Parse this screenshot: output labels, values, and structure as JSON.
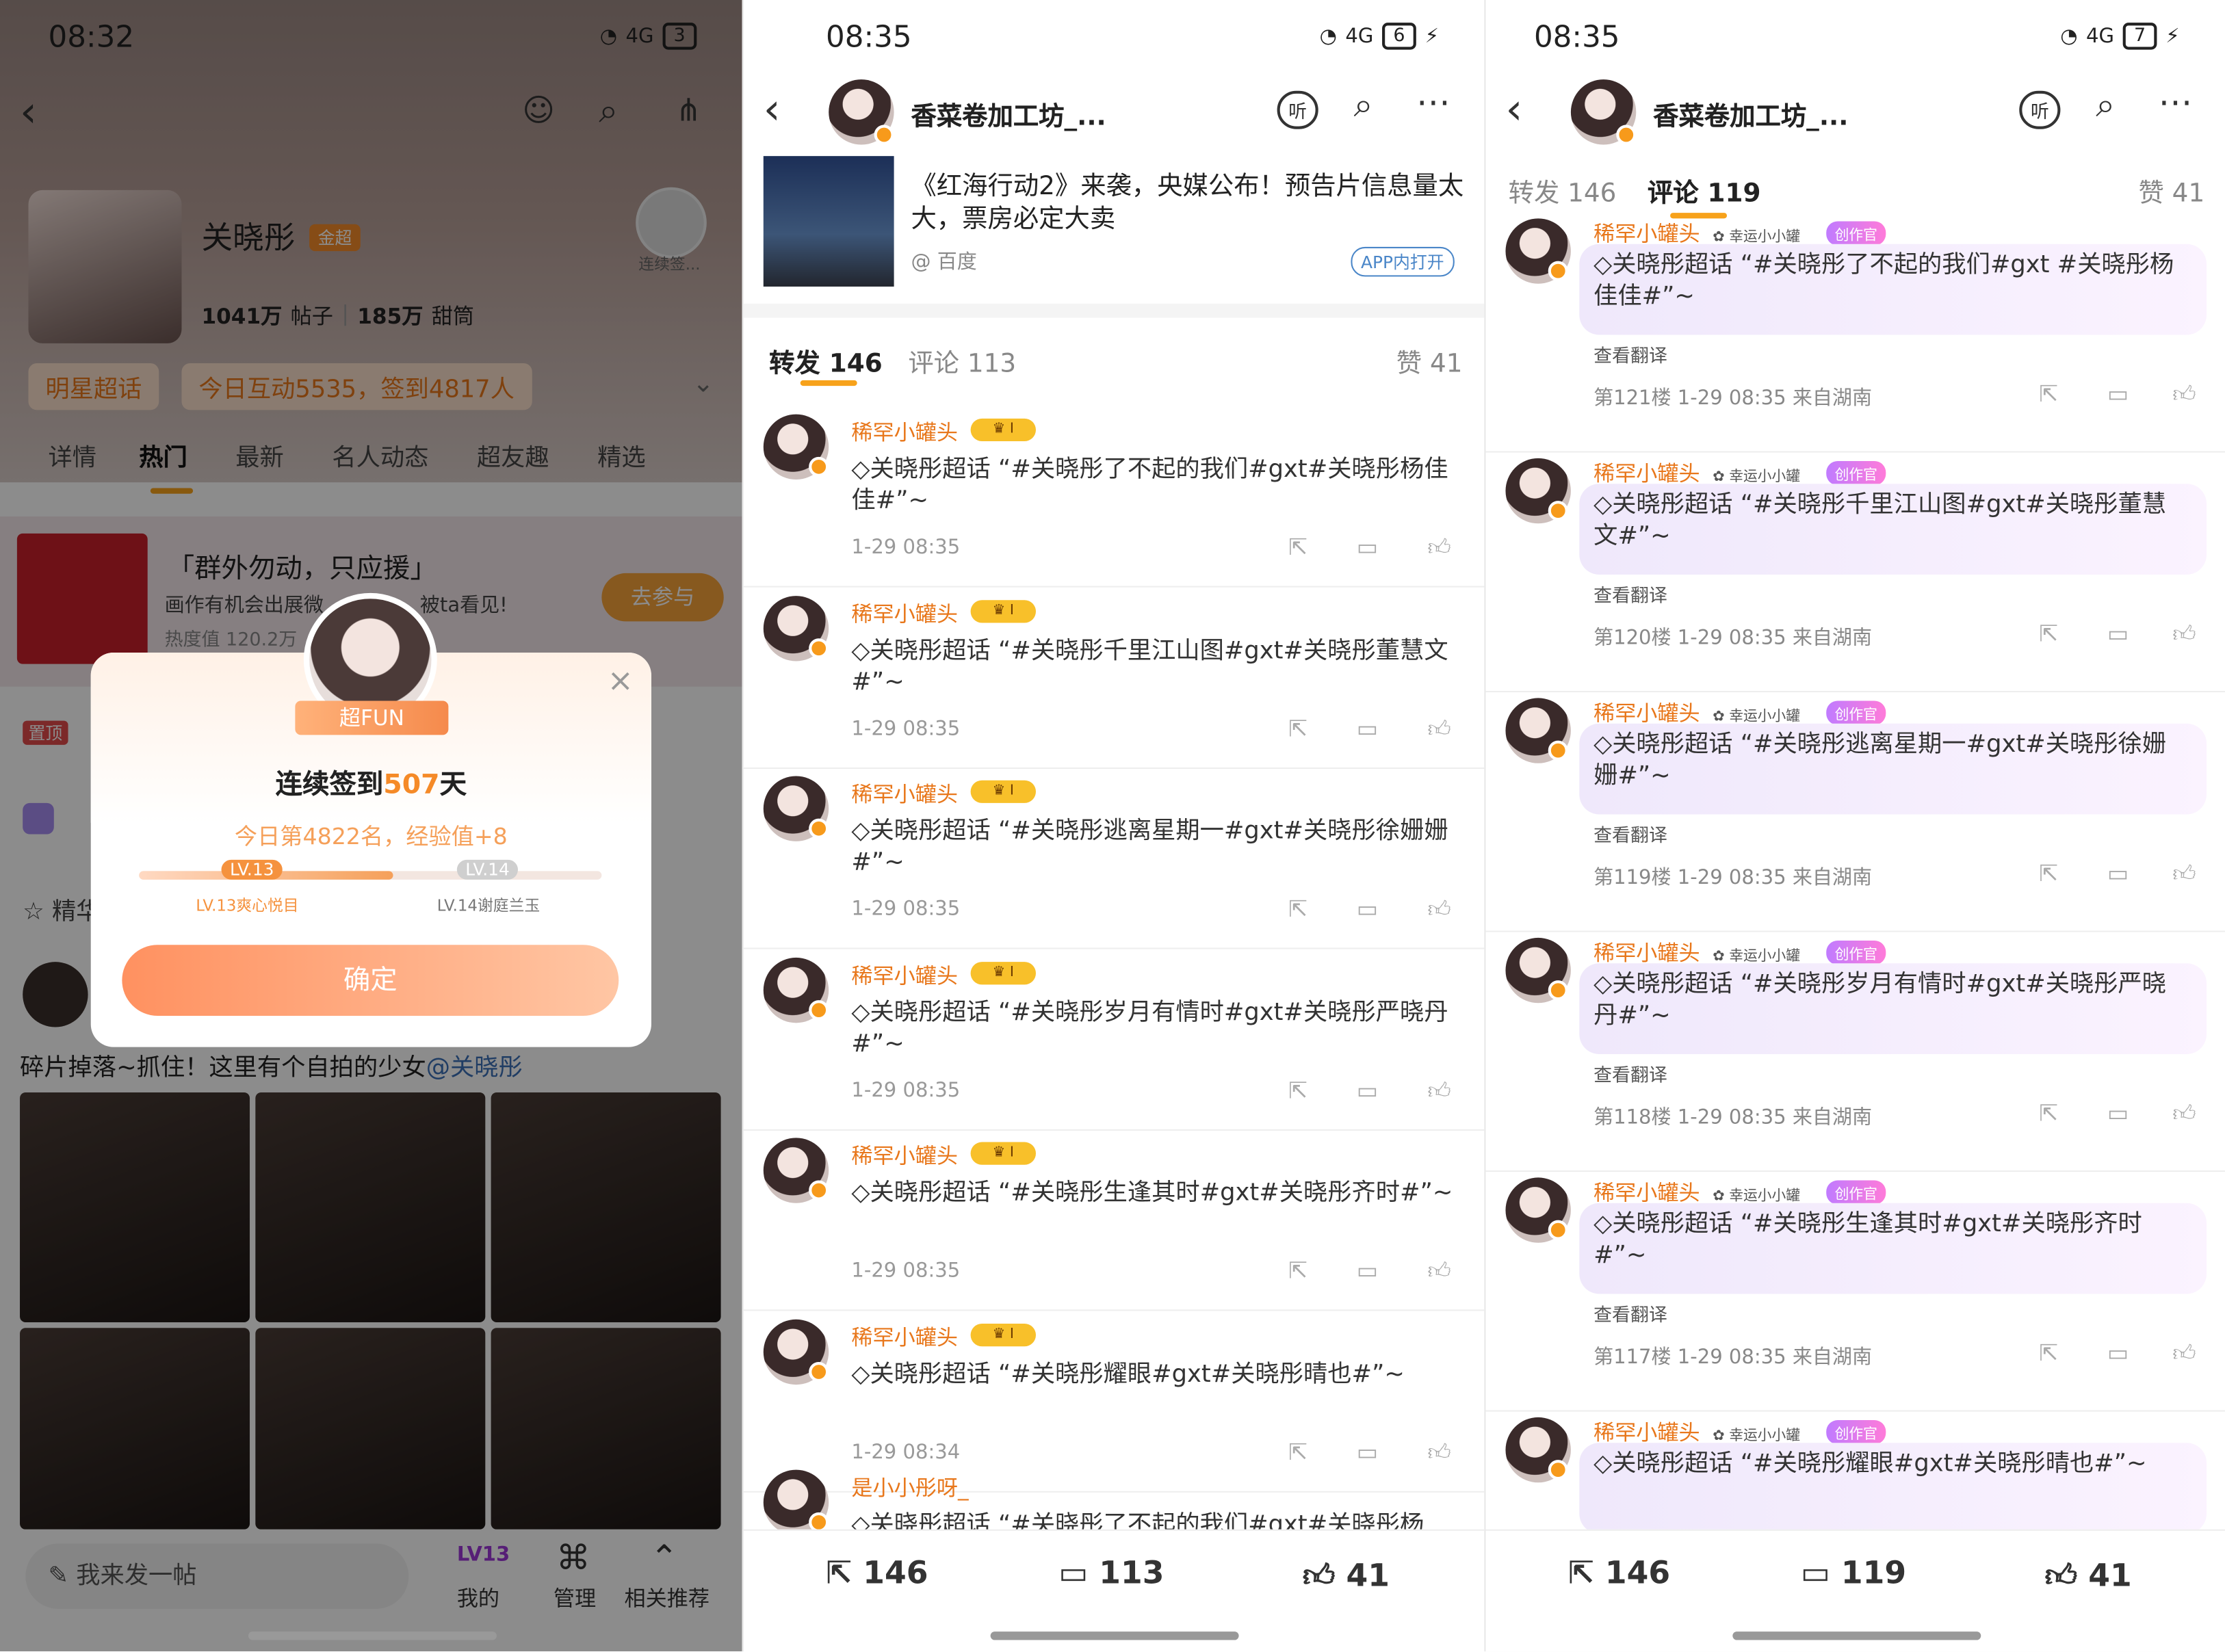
{
  "panel_left": {
    "status_time": "08:32",
    "battery": "3",
    "network": "4G",
    "topic_name": "关晓彤",
    "badge_level": "金超",
    "checkin_label": "连续签...",
    "stats_posts_value": "1041万",
    "stats_posts_label": "帖子",
    "stats_fans_value": "185万",
    "stats_fans_label": "甜筒",
    "tag_super": "明星超话",
    "tag_interaction": "今日互动5535，签到4817人",
    "tabs": [
      "详情",
      "热门",
      "最新",
      "名人动态",
      "超友趣",
      "精选"
    ],
    "banner_title": "「群外勿动，只应援」",
    "banner_sub": "画作有机会出展微",
    "banner_sub2": "被ta看见!",
    "banner_heat": "热度值 120.2万",
    "banner_join": "去参与",
    "pinned_label": "置顶",
    "fav_label": "精华",
    "post_text": "碎片掉落~抓住！这里有个自拍的少女",
    "post_mention": "@关晓彤",
    "compose_placeholder": "我来发一帖",
    "nav": [
      "我的",
      "管理",
      "相关推荐"
    ],
    "nav_level": "LV13",
    "modal": {
      "badge": "超FUN",
      "title_prefix": "连续签到",
      "days": "507",
      "title_suffix": "天",
      "rank_line": "今日第4822名，经验值+8",
      "level_current": "LV.13",
      "level_next": "LV.14",
      "level_current_name": "LV.13爽心悦目",
      "level_next_name": "LV.14谢庭兰玉",
      "level_progress_pct": 55,
      "confirm": "确定"
    }
  },
  "panel_middle": {
    "status_time": "08:35",
    "battery": "6",
    "network": "4G",
    "account_name": "香菜卷加工坊_...",
    "listen": "听",
    "article_title": "《红海行动2》来袭，央媒公布！预告片信息量太大，票房必定大卖",
    "article_source": "@ 百度",
    "article_open": "APP内打开",
    "tab_repost": "转发 146",
    "tab_comment": "评论 113",
    "likes": "赞 41",
    "reposts": [
      {
        "user": "稀罕小罐头",
        "text": "关晓彤超话 “#关晓彤了不起的我们#gxt#关晓彤杨佳佳#”~",
        "time": "1-29 08:35"
      },
      {
        "user": "稀罕小罐头",
        "text": "关晓彤超话 “#关晓彤千里江山图#gxt#关晓彤董慧文#”~",
        "time": "1-29 08:35"
      },
      {
        "user": "稀罕小罐头",
        "text": "关晓彤超话 “#关晓彤逃离星期一#gxt#关晓彤徐姗姗#”~",
        "time": "1-29 08:35"
      },
      {
        "user": "稀罕小罐头",
        "text": "关晓彤超话 “#关晓彤岁月有情时#gxt#关晓彤严晓丹#”~",
        "time": "1-29 08:35"
      },
      {
        "user": "稀罕小罐头",
        "text": "关晓彤超话 “#关晓彤生逢其时#gxt#关晓彤齐时#”~",
        "time": "1-29 08:35"
      },
      {
        "user": "稀罕小罐头",
        "text": "关晓彤超话 “#关晓彤耀眼#gxt#关晓彤晴也#”~",
        "time": "1-29 08:34"
      },
      {
        "user": "是小小彤呀_",
        "text": "关晓彤超话 “#关晓彤了不起的我们#gxt#关晓彤杨",
        "time": ""
      }
    ],
    "bottom": {
      "repost": "146",
      "comment": "113",
      "like": "41"
    }
  },
  "panel_right": {
    "status_time": "08:35",
    "battery": "7",
    "network": "4G",
    "account_name": "香菜卷加工坊_...",
    "listen": "听",
    "tab_repost": "转发 146",
    "tab_comment": "评论 119",
    "likes": "赞 41",
    "fan_label": "幸运小小罐",
    "creator_label": "创作官",
    "translate": "查看翻译",
    "comments": [
      {
        "user": "稀罕小罐头",
        "text": "关晓彤超话 “#关晓彤了不起的我们#",
        "text2": "gxt #关晓彤杨佳佳#”~",
        "meta": "第121楼 1-29 08:35 来自湖南"
      },
      {
        "user": "稀罕小罐头",
        "text": "关晓彤超话 “#关晓彤千里江山图#gxt#关晓彤董慧文#”~",
        "text2": "",
        "meta": "第120楼 1-29 08:35 来自湖南"
      },
      {
        "user": "稀罕小罐头",
        "text": "关晓彤超话 “#关晓彤逃离星期一#gxt#关晓彤徐姗姗#”~",
        "text2": "",
        "meta": "第119楼 1-29 08:35 来自湖南"
      },
      {
        "user": "稀罕小罐头",
        "text": "关晓彤超话 “#关晓彤岁月有情时#gxt#关晓彤严晓丹#”~",
        "text2": "",
        "meta": "第118楼 1-29 08:35 来自湖南"
      },
      {
        "user": "稀罕小罐头",
        "text": "关晓彤超话 “#关晓彤生逢其时#gxt#关晓彤齐时#”~",
        "text2": "",
        "meta": "第117楼 1-29 08:35 来自湖南"
      },
      {
        "user": "稀罕小罐头",
        "text": "关晓彤超话 “#关晓彤耀眼#gxt#关晓彤晴也#”~",
        "text2": "",
        "meta": ""
      }
    ],
    "bottom": {
      "repost": "146",
      "comment": "119",
      "like": "41"
    }
  },
  "colors": {
    "accent": "#f7a21b",
    "orange": "#e8771b",
    "button": "#ff9a6a"
  }
}
